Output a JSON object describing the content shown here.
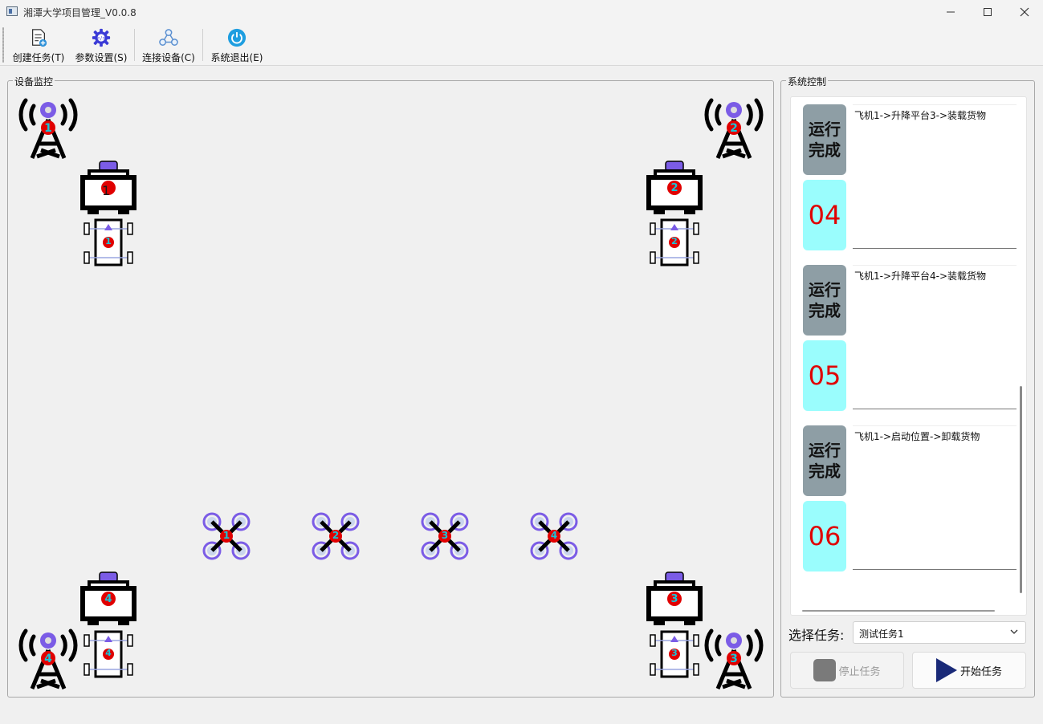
{
  "window": {
    "title": "湘潭大学项目管理_V0.0.8",
    "controls": [
      "minimize",
      "maximize",
      "close"
    ]
  },
  "toolbar": {
    "items": [
      {
        "label": "创建任务(T)",
        "icon": "create-task-icon"
      },
      {
        "label": "参数设置(S)",
        "icon": "settings-gear-icon"
      },
      {
        "label": "连接设备(C)",
        "icon": "connect-device-icon"
      },
      {
        "label": "系统退出(E)",
        "icon": "power-icon"
      }
    ]
  },
  "monitor": {
    "title": "设备监控",
    "towers": [
      "1",
      "2",
      "3",
      "4"
    ],
    "platforms": [
      "1",
      "2",
      "4",
      "3"
    ],
    "cars": [
      "1",
      "2",
      "4",
      "3"
    ],
    "drones": [
      "1",
      "2",
      "3",
      "4"
    ],
    "colors": {
      "badge_red": "#e00000",
      "purple": "#7b5ce6",
      "badge_text_cyan": "#19c4d8"
    }
  },
  "control": {
    "title": "系统控制",
    "tasks": [
      {
        "status": "运行完成",
        "number": "04",
        "text": "飞机1->升降平台3->装载货物"
      },
      {
        "status": "运行完成",
        "number": "05",
        "text": "飞机1->升降平台4->装载货物"
      },
      {
        "status": "运行完成",
        "number": "06",
        "text": "飞机1->启动位置->卸载货物"
      }
    ],
    "select_label": "选择任务:",
    "select_value": "测试任务1",
    "stop_label": "停止任务",
    "start_label": "开始任务",
    "colors": {
      "status_bg": "#8e9ea5",
      "number_bg": "#9afdfd",
      "number_fg": "#e00000",
      "start_icon": "#1a2a78"
    }
  }
}
